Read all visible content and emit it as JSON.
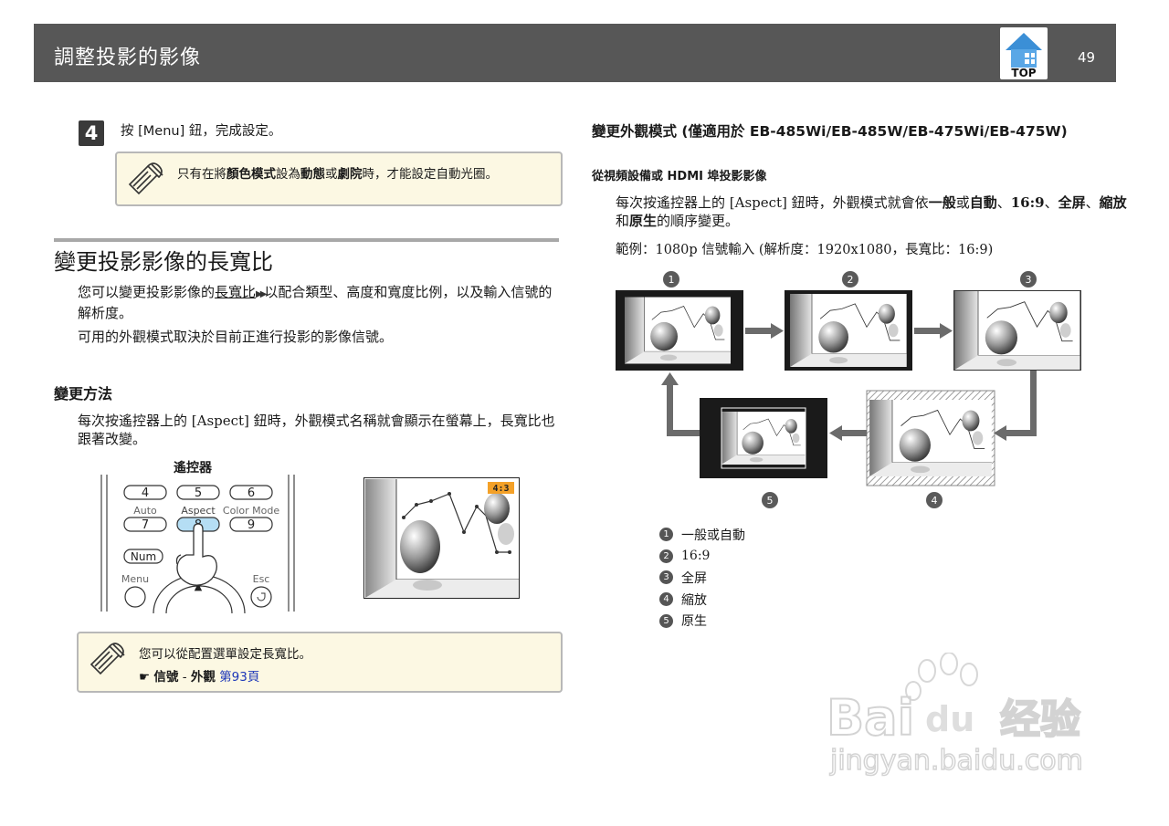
{
  "header": {
    "title": "調整投影的影像",
    "top_label": "TOP",
    "page_number": "49"
  },
  "left": {
    "step": {
      "number": "4",
      "text": "按 [Menu] 鈕，完成設定。"
    },
    "note1": {
      "p1": "只有在將",
      "b1": "顏色模式",
      "p2": "設為",
      "b2": "動態",
      "p3": "或",
      "b3": "劇院",
      "p4": "時，才能設定自動光圈。"
    },
    "section_title": "變更投影影像的長寬比",
    "intro1": {
      "pre": "您可以變更投影影像的",
      "link": "長寬比",
      "arrows": "▶▶",
      "post": "以配合類型、高度和寬度比例，以及輸入信號的解析度。"
    },
    "intro2": "可用的外觀模式取決於目前正進行投影的影像信號。",
    "method_title": "變更方法",
    "method_text": "每次按遙控器上的 [Aspect] 鈕時，外觀模式名稱就會顯示在螢幕上，長寬比也跟著改變。",
    "remote": {
      "title": "遙控器",
      "keys": [
        "4",
        "5",
        "6",
        "7",
        "8",
        "9"
      ],
      "labels": [
        "Auto",
        "Aspect",
        "Color Mode"
      ],
      "num": "Num",
      "menu": "Menu",
      "esc": "Esc",
      "up": "▲"
    },
    "screen_badge": "4:3",
    "note2": {
      "text": "您可以從配置選單設定長寬比。",
      "ref_prefix": "☛",
      "ref_b1": "信號",
      "ref_sep": " - ",
      "ref_b2": "外觀",
      "ref_link": "第93頁"
    }
  },
  "right": {
    "title": "變更外觀模式 (僅適用於 EB-485Wi/EB-485W/EB-475Wi/EB-475W)",
    "subtitle": "從視頻設備或 HDMI 埠投影影像",
    "para": {
      "t1": "每次按遙控器上的 [Aspect] 鈕時，外觀模式就會依",
      "b1": "一般",
      "t2": "或",
      "b2": "自動",
      "t3": "、",
      "b3": "16:9",
      "t4": "、",
      "b4": "全屏",
      "t5": "、",
      "b5": "縮放",
      "t6": "和",
      "b6": "原生",
      "t7": "的順序變更。"
    },
    "example": "範例：1080p 信號輸入 (解析度：1920x1080，長寬比：16:9)",
    "diagram_markers": [
      "1",
      "2",
      "3",
      "5",
      "4"
    ],
    "legend": [
      {
        "num": "1",
        "label": "一般或自動"
      },
      {
        "num": "2",
        "label": "16:9"
      },
      {
        "num": "3",
        "label": "全屏"
      },
      {
        "num": "4",
        "label": "縮放"
      },
      {
        "num": "5",
        "label": "原生"
      }
    ]
  },
  "watermark": {
    "brand": "Bai",
    "paw": "du",
    "cn": "经验",
    "url": "jingyan.baidu.com"
  }
}
